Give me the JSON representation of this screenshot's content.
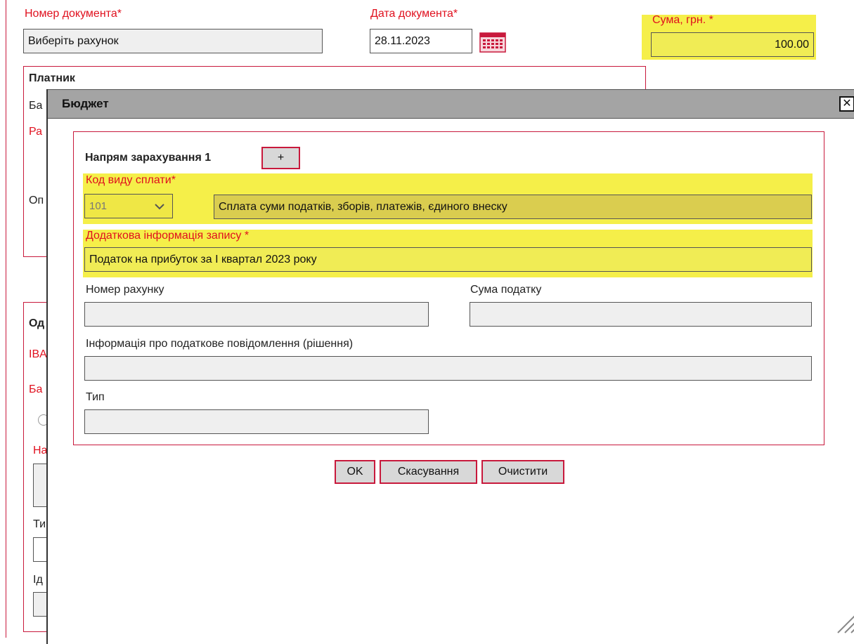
{
  "document": {
    "number_label": "Номер документа",
    "number_value": "Виберіть рахунок",
    "date_label": "Дата документа",
    "date_value": "28.11.2023",
    "sum_label": "Сума, грн.",
    "sum_value": "100.00",
    "required_mark": "*"
  },
  "payer": {
    "title": "Платник",
    "clip_ba": "Ба",
    "clip_ra": "Ра",
    "clip_op": "Оп"
  },
  "recipient": {
    "clip_od": "Од",
    "clip_iban": "IBA",
    "clip_ba": "Ба",
    "clip_na": "На",
    "clip_ty": "Ти",
    "clip_id": "Ід"
  },
  "dialog": {
    "title": "Бюджет",
    "close_glyph": "✕",
    "direction_label": "Напрям зарахування 1",
    "add_label": "+",
    "payment_code_label": "Код виду сплати",
    "payment_code_value": "101",
    "payment_code_desc": "Сплата суми податків, зборів, платежів, єдиного внеску",
    "extra_info_label": "Додаткова інформація запису",
    "extra_info_value": "Податок на прибуток за I квартал 2023 року",
    "account_number_label": "Номер рахунку",
    "account_number_value": "",
    "tax_sum_label": "Сума податку",
    "tax_sum_value": "",
    "notice_label": "Інформація про податкове повідомлення (рішення)",
    "notice_value": "",
    "type_label": "Тип",
    "type_value": "",
    "ok_label": "OK",
    "cancel_label": "Скасування",
    "clear_label": "Очистити",
    "required_mark": "*"
  },
  "colors": {
    "accent_red": "#c8193c",
    "required_red": "#e0101e",
    "highlight_yellow": "#f5ef49",
    "titlebar_gray": "#a4a4a4"
  }
}
